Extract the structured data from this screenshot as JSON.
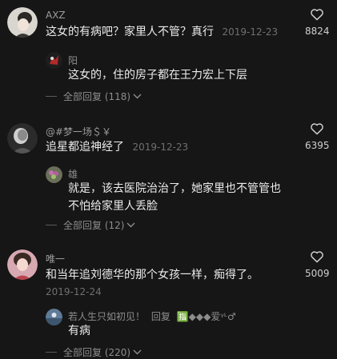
{
  "colors": {
    "background": "#161616",
    "text": "#ececec",
    "muted": "#8d8d8d",
    "date": "#6f6f6f"
  },
  "comments": [
    {
      "user": "AXZ",
      "text": "这女的有病吧？家里人不管？真行",
      "date": "2019-12-23",
      "likes": "8824",
      "reply": {
        "user": "阳",
        "text": "这女的，住的房子都在王力宏上下层"
      },
      "replies_label": "全部回复 (118)"
    },
    {
      "user": "@#梦一场＄￥",
      "text": "追星都追神经了",
      "date": "2019-12-23",
      "likes": "6395",
      "reply": {
        "user": "雄",
        "text_line1": "就是，该去医院治治了，她家里也不管管也",
        "text_line2": "不怕给家里人丢脸"
      },
      "replies_label": "全部回复 (12)"
    },
    {
      "user": "唯一",
      "text": "和当年追刘德华的那个女孩一样，痴得了。",
      "date": "2019-12-24",
      "likes": "5009",
      "reply": {
        "user": "若人生只如初见！",
        "action": "回复",
        "target": "🈯◆◆◆爱ᵞᴸ♂",
        "text": "有病"
      },
      "replies_label": "全部回复 (220)"
    }
  ]
}
